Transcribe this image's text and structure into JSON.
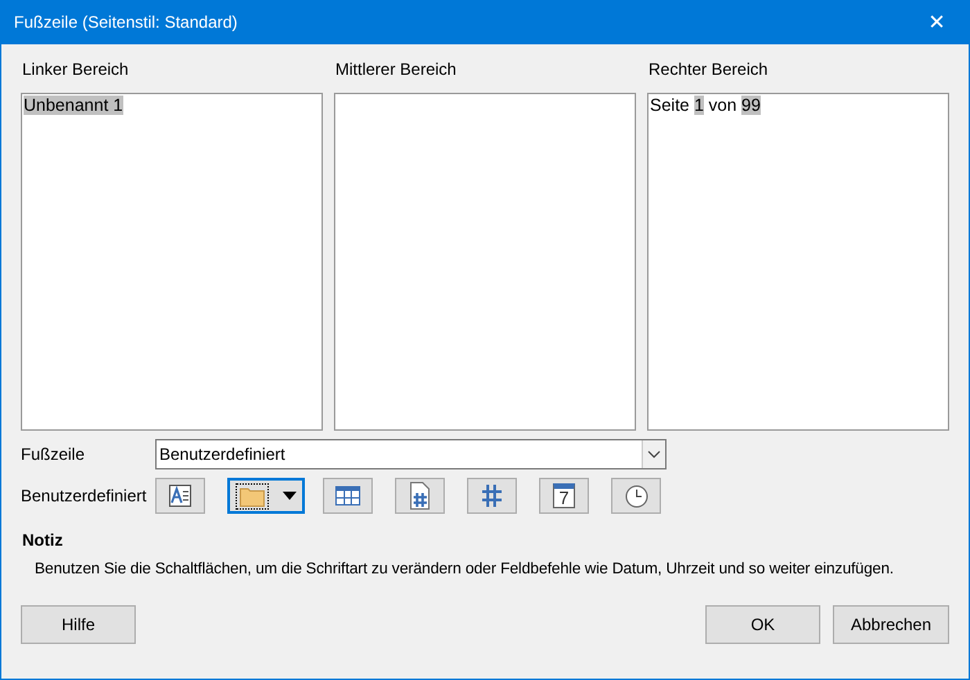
{
  "window": {
    "title": "Fußzeile (Seitenstil: Standard)",
    "close": "✕"
  },
  "areas": [
    {
      "label": "Linker Bereich",
      "content": [
        {
          "text": "Unbenannt 1",
          "field": true
        }
      ]
    },
    {
      "label": "Mittlerer Bereich"
    },
    {
      "label": "Rechter Bereich",
      "content": [
        {
          "text": "Seite ",
          "field": false
        },
        {
          "text": "1",
          "field": true
        },
        {
          "text": " von ",
          "field": false
        },
        {
          "text": "99",
          "field": true
        }
      ]
    }
  ],
  "footer_select": {
    "label": "Fußzeile",
    "value": "Benutzerdefiniert"
  },
  "custom_toolbar": {
    "label": "Benutzerdefiniert",
    "buttons": [
      {
        "kind": "font",
        "focused": false
      },
      {
        "kind": "folder",
        "focused": true
      },
      {
        "kind": "table",
        "focused": false
      },
      {
        "kind": "page-number",
        "focused": false
      },
      {
        "kind": "page-count",
        "focused": false
      },
      {
        "kind": "date",
        "focused": false,
        "icon_text": "7"
      },
      {
        "kind": "time",
        "focused": false
      }
    ]
  },
  "note": {
    "title": "Notiz",
    "text": "Benutzen Sie die Schaltflächen, um die Schriftart zu verändern oder Feldbefehle wie Datum, Uhrzeit und so weiter einzufügen."
  },
  "buttons": [
    {
      "kind": "help",
      "label": "Hilfe"
    },
    {
      "kind": "ok",
      "label": "OK"
    },
    {
      "kind": "cancel",
      "label": "Abbrechen"
    }
  ]
}
